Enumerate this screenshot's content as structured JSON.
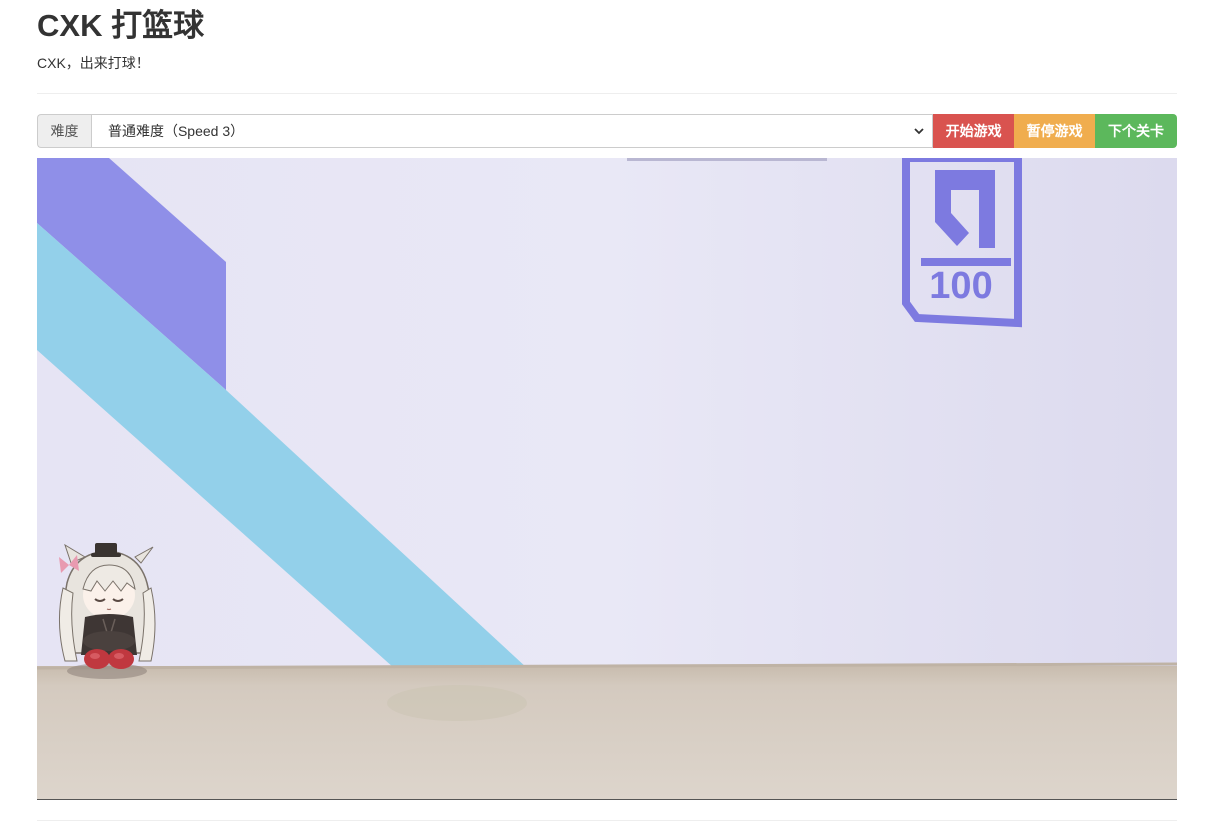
{
  "header": {
    "title": "CXK 打篮球",
    "subtitle": "CXK，出来打球！"
  },
  "controls": {
    "difficulty_label": "难度",
    "difficulty_selected": "普通难度（Speed 3）",
    "start_label": "开始游戏",
    "pause_label": "暂停游戏",
    "next_label": "下个关卡"
  },
  "scene": {
    "wall_sign_number": "100",
    "colors": {
      "wall": "#e4e3f5",
      "floor": "#d6cdc3",
      "purple_stripe": "#8f8fe8",
      "blue_stripe": "#93d0ea",
      "logo": "#7d7ae0",
      "start": "#d9534f",
      "pause": "#f0ad4e",
      "next": "#5cb85c"
    }
  }
}
